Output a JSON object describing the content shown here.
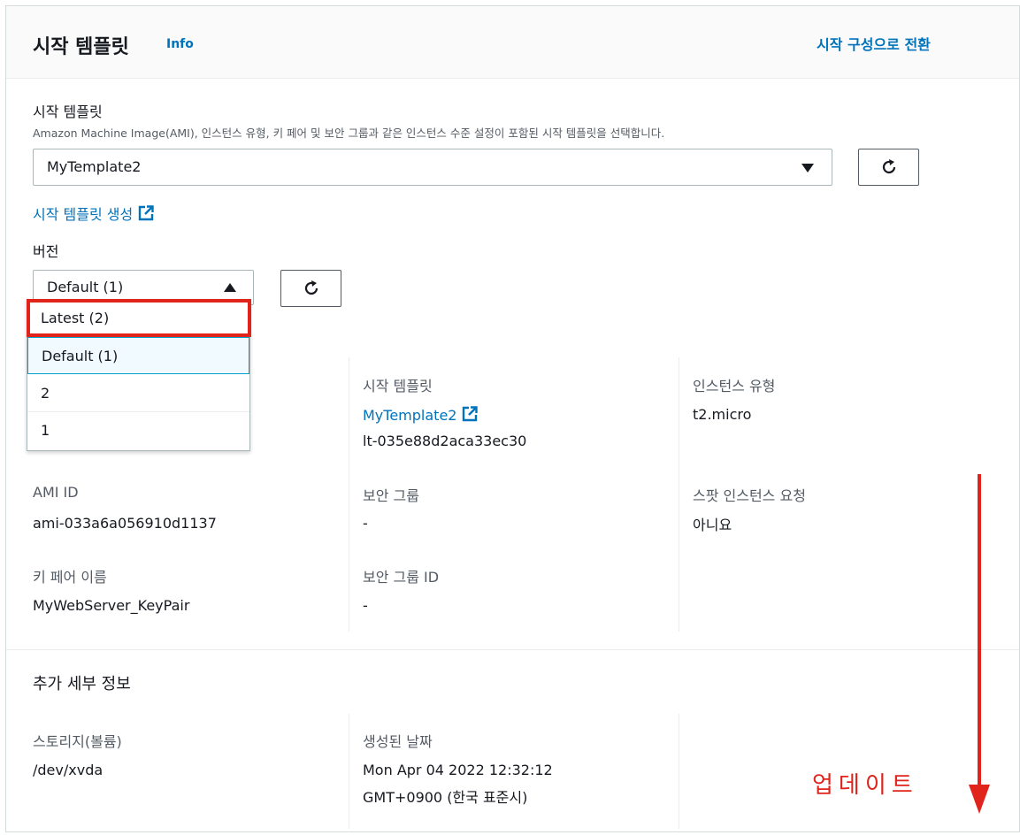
{
  "header": {
    "title": "시작 템플릿",
    "info_label": "Info",
    "switch_label": "시작 구성으로 전환"
  },
  "template_field": {
    "label": "시작 템플릿",
    "description": "Amazon Machine Image(AMI), 인스턴스 유형, 키 페어 및 보안 그룹과 같은 인스턴스 수준 설정이 포함된 시작 템플릿을 선택합니다.",
    "selected": "MyTemplate2",
    "create_link": "시작 템플릿 생성"
  },
  "version_field": {
    "label": "버전",
    "selected": "Default (1)",
    "options": [
      {
        "label": "Latest (2)",
        "selected": false
      },
      {
        "label": "Default (1)",
        "selected": true
      },
      {
        "label": "2",
        "selected": false
      },
      {
        "label": "1",
        "selected": false
      }
    ]
  },
  "details": {
    "launch_template_key": "시작 템플릿",
    "launch_template_name": "MyTemplate2",
    "launch_template_id": "lt-035e88d2aca33ec30",
    "instance_type_key": "인스턴스 유형",
    "instance_type_value": "t2.micro",
    "ami_id_key": "AMI ID",
    "ami_id_value": "ami-033a6a056910d1137",
    "security_group_key": "보안 그룹",
    "security_group_value": "-",
    "spot_key": "스팟 인스턴스 요청",
    "spot_value": "아니요",
    "key_pair_key": "키 페어 이름",
    "key_pair_value": "MyWebServer_KeyPair",
    "security_group_id_key": "보안 그룹 ID",
    "security_group_id_value": "-"
  },
  "additional": {
    "title": "추가 세부 정보",
    "storage_key": "스토리지(볼륨)",
    "storage_value": "/dev/xvda",
    "created_key": "생성된 날짜",
    "created_line1": "Mon Apr 04 2022 12:32:12",
    "created_line2": "GMT+0900 (한국 표준시)"
  },
  "annotation": {
    "text": "업데이트",
    "color": "#e0241b"
  },
  "colors": {
    "link": "#0073bb",
    "selected_bg": "#f1faff",
    "selected_border": "#00a1c9"
  }
}
